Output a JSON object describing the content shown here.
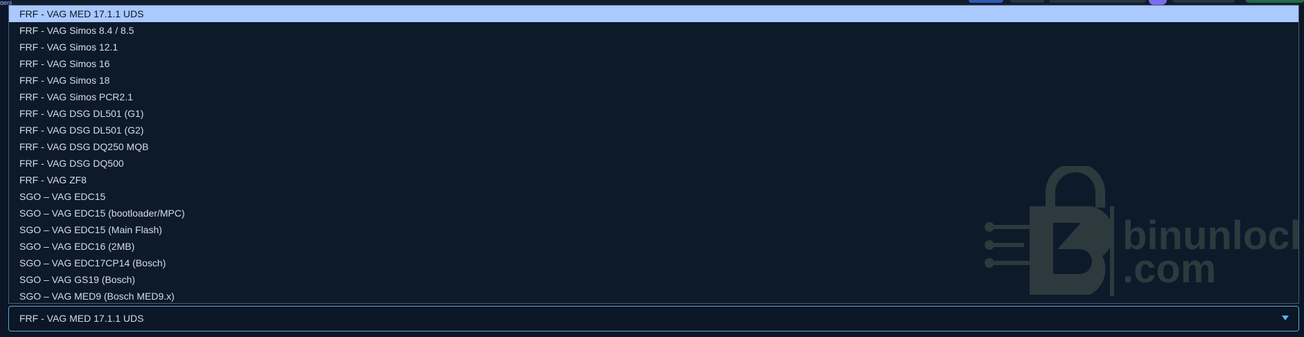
{
  "select": {
    "value": "FRF - VAG MED 17.1.1 UDS",
    "icon": "chevron-down-icon",
    "border_color": "#56a9d4"
  },
  "dropdown": {
    "selected_index": 0,
    "highlight_color": "#a9c9ff",
    "options": [
      "FRF - VAG MED 17.1.1 UDS",
      "FRF - VAG Simos 8.4 / 8.5",
      "FRF - VAG Simos 12.1",
      "FRF - VAG Simos 16",
      "FRF - VAG Simos 18",
      "FRF - VAG Simos PCR2.1",
      "FRF - VAG DSG DL501 (G1)",
      "FRF - VAG DSG DL501 (G2)",
      "FRF - VAG DSG DQ250 MQB",
      "FRF - VAG DSG DQ500",
      "FRF - VAG ZF8",
      "SGO – VAG EDC15",
      "SGO – VAG EDC15 (bootloader/MPC)",
      "SGO – VAG EDC15 (Main Flash)",
      "SGO – VAG EDC16 (2MB)",
      "SGO – VAG EDC17CP14 (Bosch)",
      "SGO – VAG GS19 (Bosch)",
      "SGO – VAG MED9 (Bosch MED9.x)"
    ]
  },
  "watermark": {
    "brand": "binunlock",
    "domain": ".com",
    "logo_letter": "B",
    "color": "#2f3d3f"
  },
  "topbar": {
    "edge_text": "geni"
  }
}
